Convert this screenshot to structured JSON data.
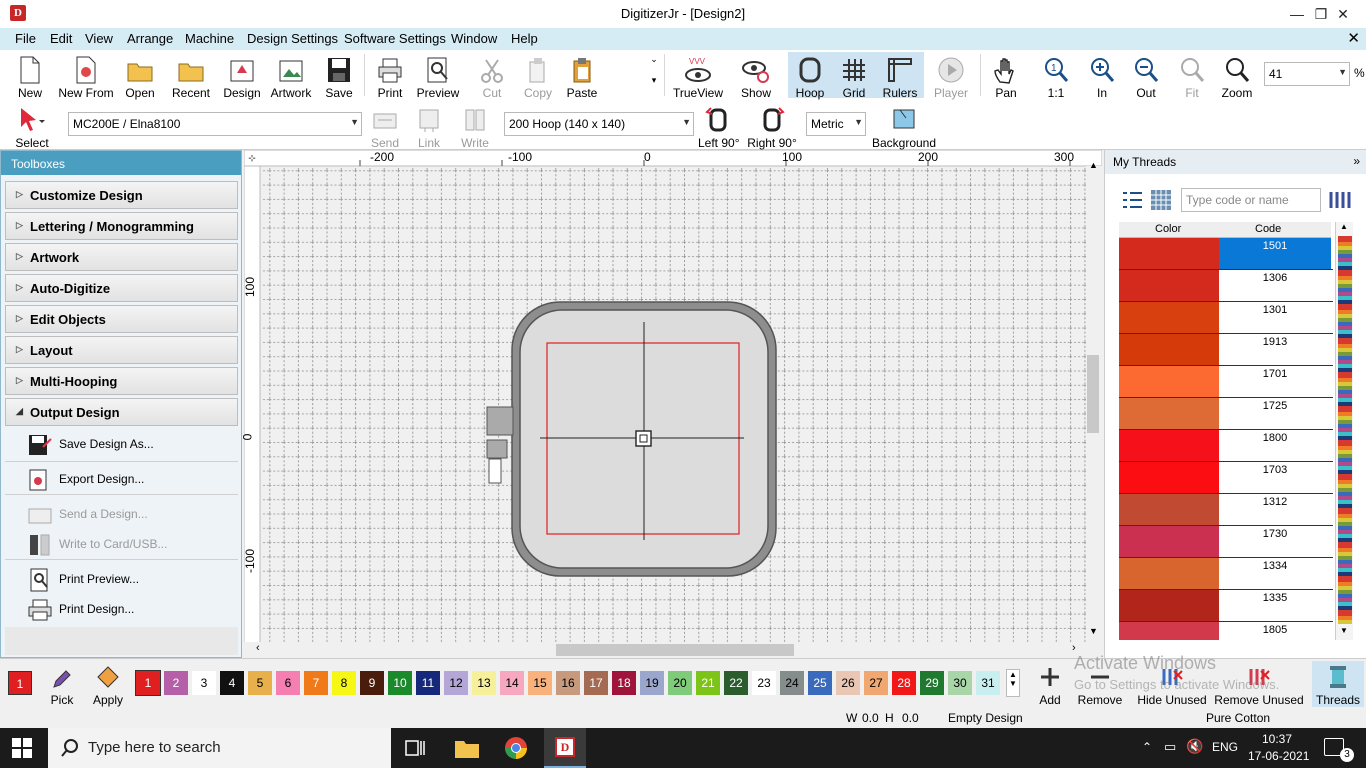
{
  "window": {
    "title": "DigitizerJr - [Design2]",
    "app_icon": "D",
    "minimize": "—",
    "restore": "❐",
    "close": "✕"
  },
  "menu": {
    "items": [
      "File",
      "Edit",
      "View",
      "Arrange",
      "Machine",
      "Design Settings",
      "Software Settings",
      "Window",
      "Help"
    ],
    "close": "✕"
  },
  "toolbar1": {
    "new": "New",
    "new_from": "New From",
    "open": "Open",
    "recent": "Recent",
    "design": "Design",
    "artwork": "Artwork",
    "save": "Save",
    "print": "Print",
    "preview": "Preview",
    "cut": "Cut",
    "copy": "Copy",
    "paste": "Paste",
    "trueview": "TrueView",
    "show": "Show",
    "hoop": "Hoop",
    "grid": "Grid",
    "rulers": "Rulers",
    "player": "Player",
    "pan": "Pan",
    "one_to_one": "1:1",
    "zoom_in": "In",
    "zoom_out": "Out",
    "fit": "Fit",
    "zoom": "Zoom",
    "zoom_value": "41",
    "zoom_unit": "%"
  },
  "toolbar2": {
    "select": "Select",
    "machine": "MC200E / Elna8100",
    "send": "Send",
    "link": "Link",
    "write": "Write",
    "hoop": "200 Hoop (140 x 140)",
    "left90": "Left 90°",
    "right90": "Right 90°",
    "units": "Metric",
    "background": "Background"
  },
  "toolboxes": {
    "title": "Toolboxes",
    "sections": [
      "Customize Design",
      "Lettering / Monogramming",
      "Artwork",
      "Auto-Digitize",
      "Edit Objects",
      "Layout",
      "Multi-Hooping",
      "Output Design"
    ],
    "output_items": [
      {
        "label": "Save Design As...",
        "enabled": true
      },
      {
        "label": "Export Design...",
        "enabled": true
      },
      {
        "label": "Send a Design...",
        "enabled": false
      },
      {
        "label": "Write to Card/USB...",
        "enabled": false
      },
      {
        "label": "Print Preview...",
        "enabled": true
      },
      {
        "label": "Print Design...",
        "enabled": true
      }
    ]
  },
  "ruler": {
    "top": [
      "-200",
      "-100",
      "0",
      "100",
      "200",
      "300"
    ],
    "left": [
      "100",
      "0",
      "-100"
    ]
  },
  "threads": {
    "title": "My Threads",
    "search_placeholder": "Type code or name",
    "col_color": "Color",
    "col_code": "Code",
    "rows": [
      {
        "code": "1501",
        "color": "#d42a1e",
        "selected": true
      },
      {
        "code": "1306",
        "color": "#d42a1e"
      },
      {
        "code": "1301",
        "color": "#d9400f"
      },
      {
        "code": "1913",
        "color": "#d43a0a"
      },
      {
        "code": "1701",
        "color": "#fc6a32"
      },
      {
        "code": "1725",
        "color": "#de6a36"
      },
      {
        "code": "1800",
        "color": "#f5101a"
      },
      {
        "code": "1703",
        "color": "#fb0d12"
      },
      {
        "code": "1312",
        "color": "#c04a32"
      },
      {
        "code": "1730",
        "color": "#cb3050"
      },
      {
        "code": "1334",
        "color": "#d8642e"
      },
      {
        "code": "1335",
        "color": "#b2251a"
      },
      {
        "code": "1805",
        "color": "#d23a4c"
      }
    ]
  },
  "palette": {
    "current": "1",
    "pick": "Pick",
    "apply": "Apply",
    "swatches": [
      {
        "n": "1",
        "c": "#e02020",
        "fg": "#fff"
      },
      {
        "n": "2",
        "c": "#b55fa8",
        "fg": "#fff"
      },
      {
        "n": "3",
        "c": "#ffffff",
        "fg": "#000"
      },
      {
        "n": "4",
        "c": "#111111",
        "fg": "#fff"
      },
      {
        "n": "5",
        "c": "#e8b04a",
        "fg": "#000"
      },
      {
        "n": "6",
        "c": "#f47fb0",
        "fg": "#000"
      },
      {
        "n": "7",
        "c": "#f07a1a",
        "fg": "#fff"
      },
      {
        "n": "8",
        "c": "#f7f716",
        "fg": "#000"
      },
      {
        "n": "9",
        "c": "#4a1c0c",
        "fg": "#fff"
      },
      {
        "n": "10",
        "c": "#1a8a2c",
        "fg": "#fff"
      },
      {
        "n": "11",
        "c": "#16287a",
        "fg": "#fff"
      },
      {
        "n": "12",
        "c": "#b4a6d6",
        "fg": "#000"
      },
      {
        "n": "13",
        "c": "#f7f09a",
        "fg": "#000"
      },
      {
        "n": "14",
        "c": "#f7a8c0",
        "fg": "#000"
      },
      {
        "n": "15",
        "c": "#f9b27c",
        "fg": "#000"
      },
      {
        "n": "16",
        "c": "#c79a7e",
        "fg": "#000"
      },
      {
        "n": "17",
        "c": "#a46a52",
        "fg": "#fff"
      },
      {
        "n": "18",
        "c": "#a0143c",
        "fg": "#fff"
      },
      {
        "n": "19",
        "c": "#9aa6cc",
        "fg": "#000"
      },
      {
        "n": "20",
        "c": "#7fcb7a",
        "fg": "#000"
      },
      {
        "n": "21",
        "c": "#7cc418",
        "fg": "#fff"
      },
      {
        "n": "22",
        "c": "#2a5c2e",
        "fg": "#fff"
      },
      {
        "n": "23",
        "c": "#ffffff",
        "fg": "#000"
      },
      {
        "n": "24",
        "c": "#848c8c",
        "fg": "#000"
      },
      {
        "n": "25",
        "c": "#3a6abb",
        "fg": "#fff"
      },
      {
        "n": "26",
        "c": "#eac6b4",
        "fg": "#000"
      },
      {
        "n": "27",
        "c": "#f1a870",
        "fg": "#000"
      },
      {
        "n": "28",
        "c": "#f21818",
        "fg": "#fff"
      },
      {
        "n": "29",
        "c": "#1f7a30",
        "fg": "#fff"
      },
      {
        "n": "30",
        "c": "#a8d6a8",
        "fg": "#000"
      },
      {
        "n": "31",
        "c": "#c8eef0",
        "fg": "#000"
      }
    ],
    "add": "Add",
    "remove": "Remove",
    "hide_unused": "Hide Unused",
    "remove_unused": "Remove Unused",
    "threads": "Threads"
  },
  "status": {
    "w": "W",
    "w_val": "0.0",
    "h": "H",
    "h_val": "0.0",
    "design": "Empty Design",
    "thread": "Pure Cotton"
  },
  "watermark": {
    "line1": "Activate Windows",
    "line2": "Go to Settings to activate Windows."
  },
  "taskbar": {
    "search": "Type here to search",
    "lang": "ENG",
    "time": "10:37",
    "date": "17-06-2021",
    "notifications": "3"
  }
}
